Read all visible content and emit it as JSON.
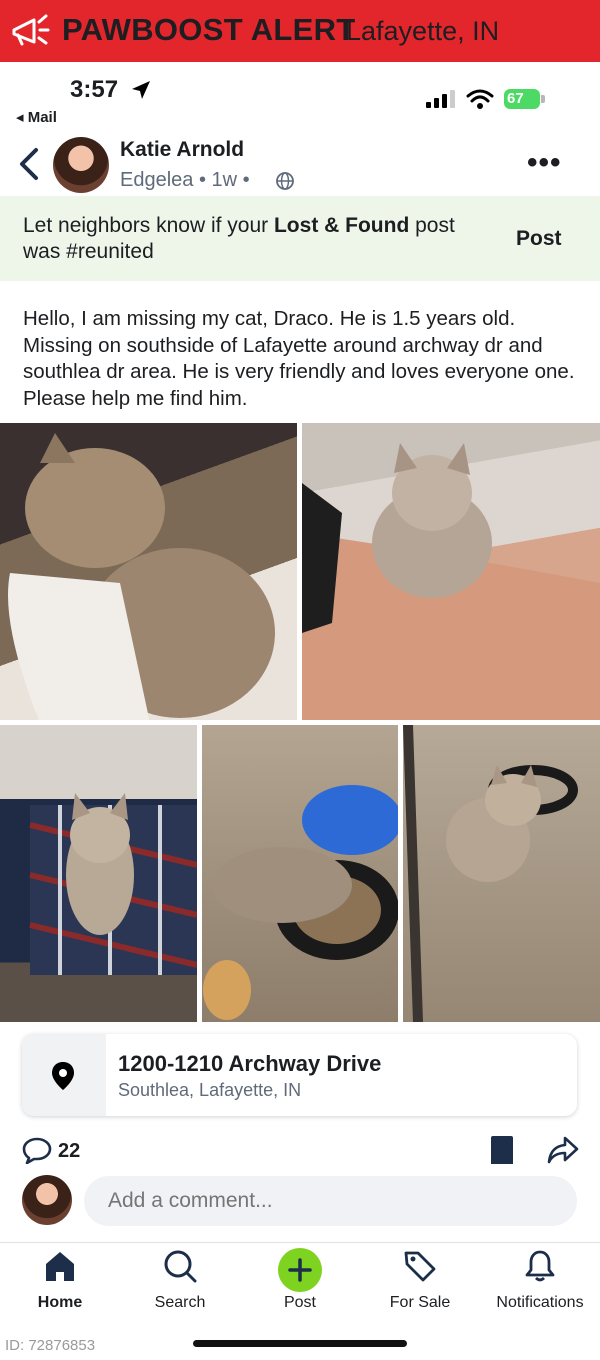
{
  "alert": {
    "title": "PAWBOOST ALERT",
    "city": "Lafayette, IN"
  },
  "status_bar": {
    "time": "3:57",
    "back_app": "◂ Mail",
    "battery": "67"
  },
  "post": {
    "author": "Katie Arnold",
    "meta": "Edgelea • 1w •",
    "more": "•••",
    "reunite_pre": "Let neighbors know if your ",
    "reunite_bold": "Lost & Found",
    "reunite_post": " post was #reunited",
    "reunite_button": "Post",
    "body": "Hello, I am missing my cat, Draco. He is 1.5 years old. Missing on southside of Lafayette around archway dr and southlea dr area. He is very friendly and loves everyone one. Please help me find him.",
    "location": {
      "address": "1200-1210 Archway Drive",
      "area": "Southlea, Lafayette, IN"
    },
    "comment_count": "22",
    "comment_placeholder": "Add a comment..."
  },
  "nav": {
    "home": "Home",
    "search": "Search",
    "post": "Post",
    "for_sale": "For Sale",
    "notifications": "Notifications"
  },
  "footer_id": "ID: 72876853",
  "colors": {
    "alert_red": "#e3262c",
    "post_green": "#7ed321",
    "reunite_bg": "#eef6ea"
  }
}
